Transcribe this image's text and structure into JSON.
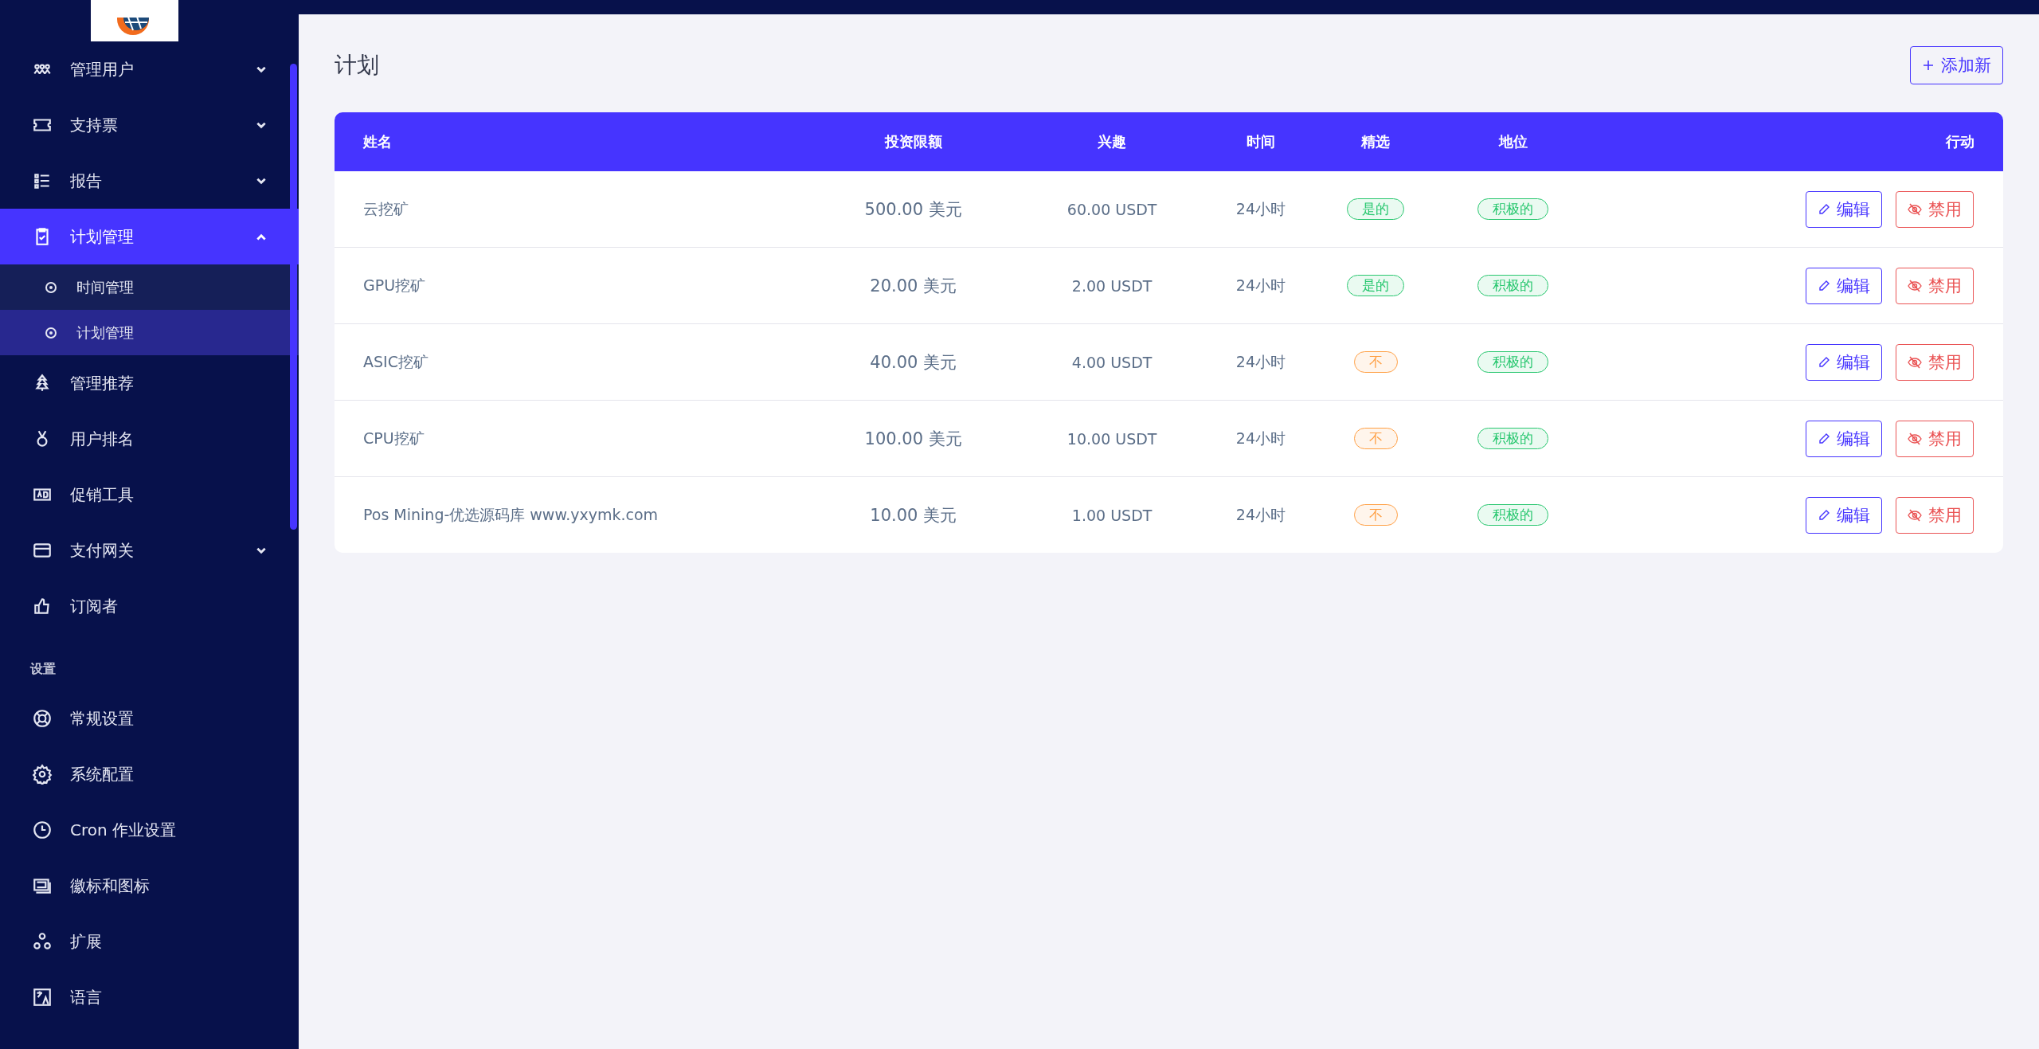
{
  "sidebar": {
    "items": [
      {
        "label": "管理用户",
        "expanded": false,
        "selected": false
      },
      {
        "label": "支持票",
        "expanded": false,
        "selected": false
      },
      {
        "label": "报告",
        "expanded": false,
        "selected": false
      },
      {
        "label": "计划管理",
        "expanded": true,
        "selected": true,
        "children": [
          {
            "label": "时间管理",
            "selected": false
          },
          {
            "label": "计划管理",
            "selected": true
          }
        ]
      },
      {
        "label": "管理推荐",
        "selected": false
      },
      {
        "label": "用户排名",
        "selected": false
      },
      {
        "label": "促销工具",
        "selected": false
      },
      {
        "label": "支付网关",
        "expanded": false,
        "selected": false
      },
      {
        "label": "订阅者",
        "selected": false
      }
    ],
    "section_title": "设置",
    "settings_items": [
      {
        "label": "常规设置"
      },
      {
        "label": "系统配置"
      },
      {
        "label": "Cron 作业设置"
      },
      {
        "label": "徽标和图标"
      },
      {
        "label": "扩展"
      },
      {
        "label": "语言"
      }
    ]
  },
  "page": {
    "title": "计划",
    "add_button": "添加新"
  },
  "table": {
    "columns": [
      "姓名",
      "投资限额",
      "兴趣",
      "时间",
      "精选",
      "地位",
      "行动"
    ],
    "rows": [
      {
        "name": "云挖矿",
        "limit": "500.00 美元",
        "interest": "60.00 USDT",
        "time": "24小时",
        "featured": {
          "text": "是的",
          "kind": "success"
        },
        "status": {
          "text": "积极的",
          "kind": "success"
        },
        "edit": "编辑",
        "disable": "禁用"
      },
      {
        "name": "GPU挖矿",
        "limit": "20.00 美元",
        "interest": "2.00 USDT",
        "time": "24小时",
        "featured": {
          "text": "是的",
          "kind": "success"
        },
        "status": {
          "text": "积极的",
          "kind": "success"
        },
        "edit": "编辑",
        "disable": "禁用"
      },
      {
        "name": "ASIC挖矿",
        "limit": "40.00 美元",
        "interest": "4.00 USDT",
        "time": "24小时",
        "featured": {
          "text": "不",
          "kind": "warning"
        },
        "status": {
          "text": "积极的",
          "kind": "success"
        },
        "edit": "编辑",
        "disable": "禁用"
      },
      {
        "name": "CPU挖矿",
        "limit": "100.00 美元",
        "interest": "10.00 USDT",
        "time": "24小时",
        "featured": {
          "text": "不",
          "kind": "warning"
        },
        "status": {
          "text": "积极的",
          "kind": "success"
        },
        "edit": "编辑",
        "disable": "禁用"
      },
      {
        "name": "Pos Mining-优选源码库 www.yxymk.com",
        "limit": "10.00 美元",
        "interest": "1.00 USDT",
        "time": "24小时",
        "featured": {
          "text": "不",
          "kind": "warning"
        },
        "status": {
          "text": "积极的",
          "kind": "success"
        },
        "edit": "编辑",
        "disable": "禁用"
      }
    ]
  }
}
